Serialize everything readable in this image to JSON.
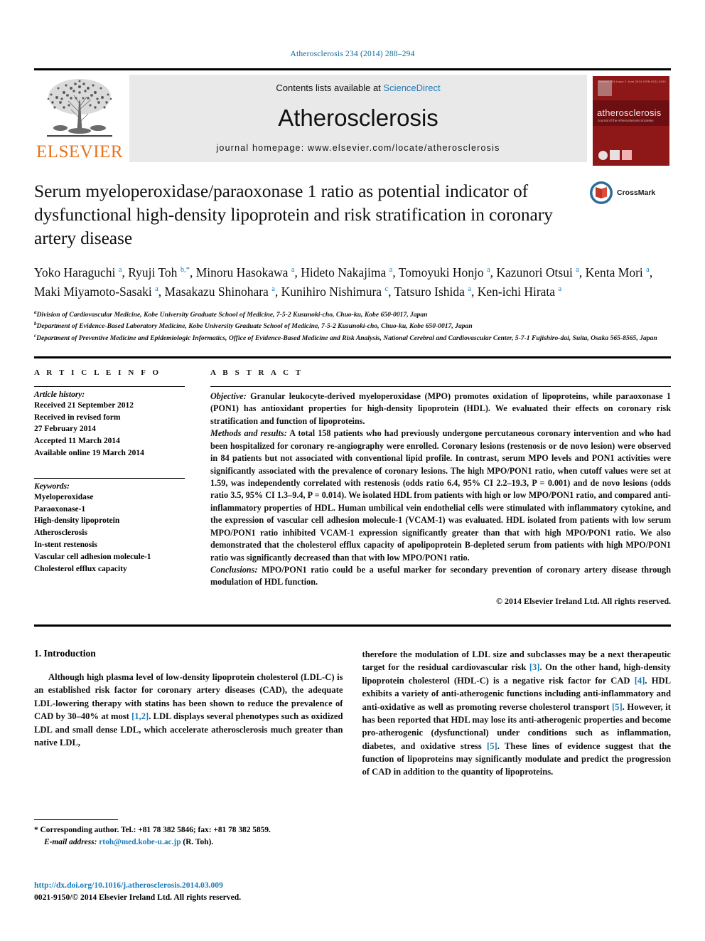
{
  "running_head": "Atherosclerosis 234 (2014) 288–294",
  "masthead": {
    "publisher": "ELSEVIER",
    "contents_prefix": "Contents lists available at ",
    "contents_link": "ScienceDirect",
    "journal_name": "Atherosclerosis",
    "homepage": "journal homepage: www.elsevier.com/locate/atherosclerosis",
    "cover_title": "atherosclerosis",
    "cover_subtitle": "Journal of the Atherosclerosis Societies",
    "cover_topline": "Volume 234 Issue 2   June 2014   ISSN 0021-9150"
  },
  "article": {
    "title": "Serum myeloperoxidase/paraoxonase 1 ratio as potential indicator of dysfunctional high-density lipoprotein and risk stratification in coronary artery disease",
    "crossmark_label": "CrossMark",
    "authors_html": "Yoko Haraguchi <sup>a</sup>, Ryuji Toh <sup>b,*</sup>, Minoru Hasokawa <sup>a</sup>, Hideto Nakajima <sup>a</sup>, Tomoyuki Honjo <sup>a</sup>, Kazunori Otsui <sup>a</sup>, Kenta Mori <sup>a</sup>, Maki Miyamoto-Sasaki <sup>a</sup>, Masakazu Shinohara <sup>a</sup>, Kunihiro Nishimura <sup>c</sup>, Tatsuro Ishida <sup>a</sup>, Ken-ichi Hirata <sup>a</sup>",
    "affiliations": [
      "Division of Cardiovascular Medicine, Kobe University Graduate School of Medicine, 7-5-2 Kusunoki-cho, Chuo-ku, Kobe 650-0017, Japan",
      "Department of Evidence-Based Laboratory Medicine, Kobe University Graduate School of Medicine, 7-5-2 Kusunoki-cho, Chuo-ku, Kobe 650-0017, Japan",
      "Department of Preventive Medicine and Epidemiologic Informatics, Office of Evidence-Based Medicine and Risk Analysis, National Cerebral and Cardiovascular Center, 5-7-1 Fujishiro-dai, Suita, Osaka 565-8565, Japan"
    ],
    "affiliation_markers": [
      "a",
      "b",
      "c"
    ]
  },
  "article_info": {
    "heading": "A R T I C L E   I N F O",
    "history_label": "Article history:",
    "history": [
      "Received 21 September 2012",
      "Received in revised form",
      "27 February 2014",
      "Accepted 11 March 2014",
      "Available online 19 March 2014"
    ],
    "keywords_label": "Keywords:",
    "keywords": [
      "Myeloperoxidase",
      "Paraoxonase-1",
      "High-density lipoprotein",
      "Atherosclerosis",
      "In-stent restenosis",
      "Vascular cell adhesion molecule-1",
      "Cholesterol efflux capacity"
    ]
  },
  "abstract": {
    "heading": "A B S T R A C T",
    "objective_label": "Objective:",
    "objective_text": " Granular leukocyte-derived myeloperoxidase (MPO) promotes oxidation of lipoproteins, while paraoxonase 1 (PON1) has antioxidant properties for high-density lipoprotein (HDL). We evaluated their effects on coronary risk stratification and function of lipoproteins.",
    "methods_label": "Methods and results:",
    "methods_text": " A total 158 patients who had previously undergone percutaneous coronary intervention and who had been hospitalized for coronary re-angiography were enrolled. Coronary lesions (restenosis or de novo lesion) were observed in 84 patients but not associated with conventional lipid profile. In contrast, serum MPO levels and PON1 activities were significantly associated with the prevalence of coronary lesions. The high MPO/PON1 ratio, when cutoff values were set at 1.59, was independently correlated with restenosis (odds ratio 6.4, 95% CI 2.2–19.3, P = 0.001) and de novo lesions (odds ratio 3.5, 95% CI 1.3–9.4, P = 0.014). We isolated HDL from patients with high or low MPO/PON1 ratio, and compared anti-inflammatory properties of HDL. Human umbilical vein endothelial cells were stimulated with inflammatory cytokine, and the expression of vascular cell adhesion molecule-1 (VCAM-1) was evaluated. HDL isolated from patients with low serum MPO/PON1 ratio inhibited VCAM-1 expression significantly greater than that with high MPO/PON1 ratio. We also demonstrated that the cholesterol efflux capacity of apolipoprotein B-depleted serum from patients with high MPO/PON1 ratio was significantly decreased than that with low MPO/PON1 ratio.",
    "conclusions_label": "Conclusions:",
    "conclusions_text": " MPO/PON1 ratio could be a useful marker for secondary prevention of coronary artery disease through modulation of HDL function.",
    "copyright": "© 2014 Elsevier Ireland Ltd. All rights reserved."
  },
  "introduction": {
    "heading": "1.  Introduction",
    "left_paragraph_pre": "Although high plasma level of low-density lipoprotein cholesterol (LDL-C) is an established risk factor for coronary artery diseases (CAD), the adequate LDL-lowering therapy with statins has been shown to reduce the prevalence of CAD by 30–40% at most ",
    "left_ref_1": "[1,2]",
    "left_paragraph_post": ". LDL displays several phenotypes such as oxidized LDL and small dense LDL, which accelerate atherosclerosis much greater than native LDL,",
    "right_seg_1": "therefore the modulation of LDL size and subclasses may be a next therapeutic target for the residual cardiovascular risk ",
    "right_ref_3": "[3]",
    "right_seg_2": ". On the other hand, high-density lipoprotein cholesterol (HDL-C) is a negative risk factor for CAD ",
    "right_ref_4": "[4]",
    "right_seg_3": ". HDL exhibits a variety of anti-atherogenic functions including anti-inflammatory and anti-oxidative as well as promoting reverse cholesterol transport ",
    "right_ref_5a": "[5]",
    "right_seg_4": ". However, it has been reported that HDL may lose its anti-atherogenic properties and become pro-atherogenic (dysfunctional) under conditions such as inflammation, diabetes, and oxidative stress ",
    "right_ref_5b": "[5]",
    "right_seg_5": ". These lines of evidence suggest that the function of lipoproteins may significantly modulate and predict the progression of CAD in addition to the quantity of lipoproteins."
  },
  "footnote": {
    "corresponding_marker": "*",
    "corresponding_text": " Corresponding author. Tel.: +81 78 382 5846; fax: +81 78 382 5859.",
    "email_label": "E-mail address:",
    "email": "rtoh@med.kobe-u.ac.jp",
    "email_attrib": " (R. Toh)."
  },
  "footer": {
    "doi": "http://dx.doi.org/10.1016/j.atherosclerosis.2014.03.009",
    "issn_line": "0021-9150/© 2014 Elsevier Ireland Ltd. All rights reserved."
  },
  "colors": {
    "link_blue": "#1a7bb9",
    "elsevier_orange": "#E9711C",
    "cover_red": "#8e1818",
    "running_head_blue": "#0b6a9e"
  }
}
